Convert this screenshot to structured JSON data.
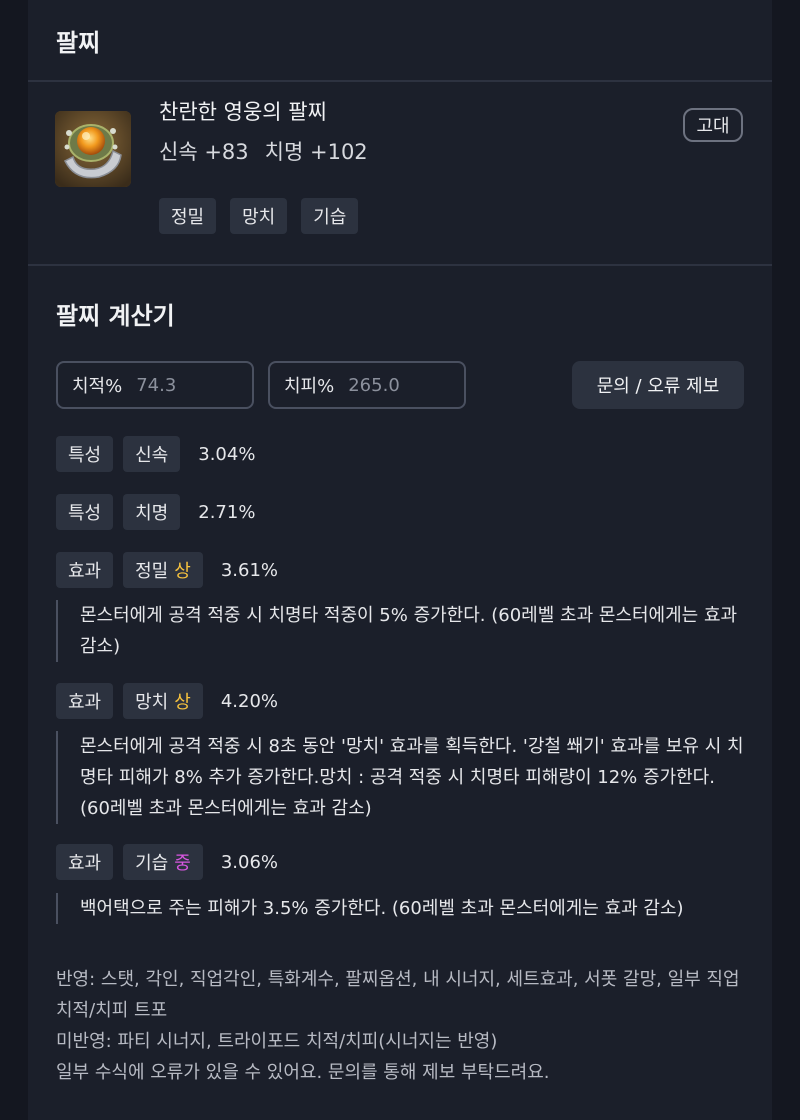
{
  "header": {
    "title": "팔찌"
  },
  "item": {
    "icon": "bracelet-item-icon",
    "name": "찬란한 영웅의 팔찌",
    "grade": "고대",
    "stats": [
      {
        "label": "신속",
        "value": "+83"
      },
      {
        "label": "치명",
        "value": "+102"
      }
    ],
    "tags": [
      "정밀",
      "망치",
      "기습"
    ]
  },
  "calculator": {
    "title": "팔찌 계산기",
    "crit_rate_label": "치적%",
    "crit_rate_value": "74.3",
    "crit_damage_label": "치피%",
    "crit_damage_value": "265.0",
    "report_button": "문의 / 오류 제보"
  },
  "rows": [
    {
      "kind": "특성",
      "name": "신속",
      "value": "3.04%"
    },
    {
      "kind": "특성",
      "name": "치명",
      "value": "2.71%"
    },
    {
      "kind": "효과",
      "name": "정밀",
      "grade": "상",
      "grade_color": "#f6c23e",
      "value": "3.61%",
      "description": "몬스터에게 공격 적중 시 치명타 적중이 5% 증가한다. (60레벨 초과 몬스터에게는 효과 감소)"
    },
    {
      "kind": "효과",
      "name": "망치",
      "grade": "상",
      "grade_color": "#f6c23e",
      "value": "4.20%",
      "description": "몬스터에게 공격 적중 시 8초 동안 '망치' 효과를 획득한다. '강철 쐐기' 효과를 보유 시 치명타 피해가 8% 추가 증가한다.망치 : 공격 적중 시 치명타 피해량이 12% 증가한다. (60레벨 초과 몬스터에게는 효과 감소)"
    },
    {
      "kind": "효과",
      "name": "기습",
      "grade": "중",
      "grade_color": "#d857e0",
      "value": "3.06%",
      "description": "백어택으로 주는 피해가 3.5% 증가한다. (60레벨 초과 몬스터에게는 효과 감소)"
    }
  ],
  "footer": {
    "reflected": "반영: 스탯, 각인, 직업각인, 특화계수, 팔찌옵션, 내 시너지, 세트효과, 서폿 갈망, 일부 직업 치적/치피 트포",
    "not_reflected": "미반영: 파티 시너지, 트라이포드 치적/치피(시너지는 반영)",
    "notice": "일부 수식에 오류가 있을 수 있어요. 문의를 통해 제보 부탁드려요."
  }
}
